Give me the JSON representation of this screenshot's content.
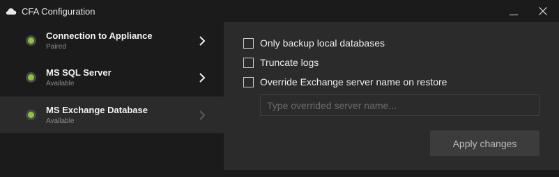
{
  "window": {
    "title": "CFA Configuration",
    "icons": {
      "app": "cloud-icon",
      "minimize": "minimize-icon",
      "close": "close-icon"
    }
  },
  "sidebar": {
    "items": [
      {
        "title": "Connection to Appliance",
        "status": "Paired",
        "status_color": "#8cc43c",
        "active": false
      },
      {
        "title": "MS SQL Server",
        "status": "Available",
        "status_color": "#8cc43c",
        "active": false
      },
      {
        "title": "MS Exchange Database",
        "status": "Available",
        "status_color": "#8cc43c",
        "active": true
      }
    ]
  },
  "options": {
    "only_backup_local": {
      "label": "Only backup local databases",
      "checked": false
    },
    "truncate_logs": {
      "label": "Truncate logs",
      "checked": false
    },
    "override_server_name": {
      "label": "Override Exchange server name on restore",
      "checked": false
    }
  },
  "server_name_input": {
    "value": "",
    "placeholder": "Type overrided server name..."
  },
  "apply_button": {
    "label": "Apply changes",
    "enabled": false
  },
  "colors": {
    "background": "#1b1b1b",
    "panel": "#2b2b2b",
    "status_ok": "#8cc43c",
    "button": "#3c3c3c"
  }
}
